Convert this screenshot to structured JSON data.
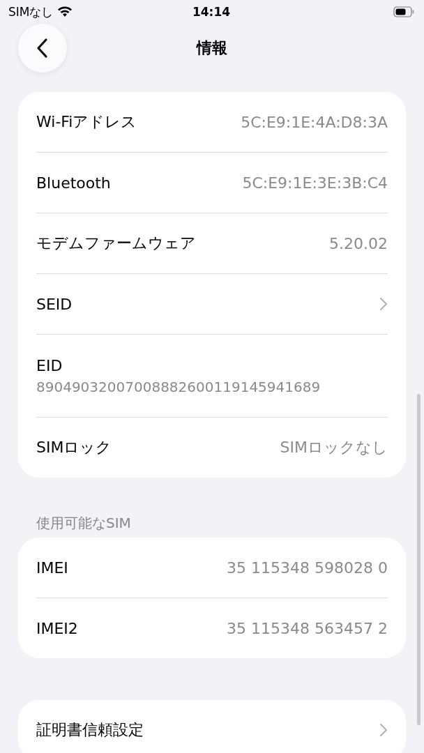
{
  "status_bar": {
    "carrier": "SIMなし",
    "time": "14:14"
  },
  "nav": {
    "title": "情報"
  },
  "groups": [
    {
      "rows": [
        {
          "kind": "value",
          "label": "Wi-Fiアドレス",
          "value": "5C:E9:1E:4A:D8:3A"
        },
        {
          "kind": "value",
          "label": "Bluetooth",
          "value": "5C:E9:1E:3E:3B:C4"
        },
        {
          "kind": "value",
          "label": "モデムファームウェア",
          "value": "5.20.02"
        },
        {
          "kind": "link",
          "label": "SEID"
        },
        {
          "kind": "stacked",
          "label": "EID",
          "value": "89049032007008882600119145941689"
        },
        {
          "kind": "value",
          "label": "SIMロック",
          "value": "SIMロックなし"
        }
      ]
    },
    {
      "header": "使用可能なSIM",
      "rows": [
        {
          "kind": "value",
          "label": "IMEI",
          "value": "35 115348 598028 0"
        },
        {
          "kind": "value",
          "label": "IMEI2",
          "value": "35 115348 563457 2"
        }
      ]
    },
    {
      "rows": [
        {
          "kind": "link",
          "label": "証明書信頼設定"
        }
      ]
    }
  ]
}
